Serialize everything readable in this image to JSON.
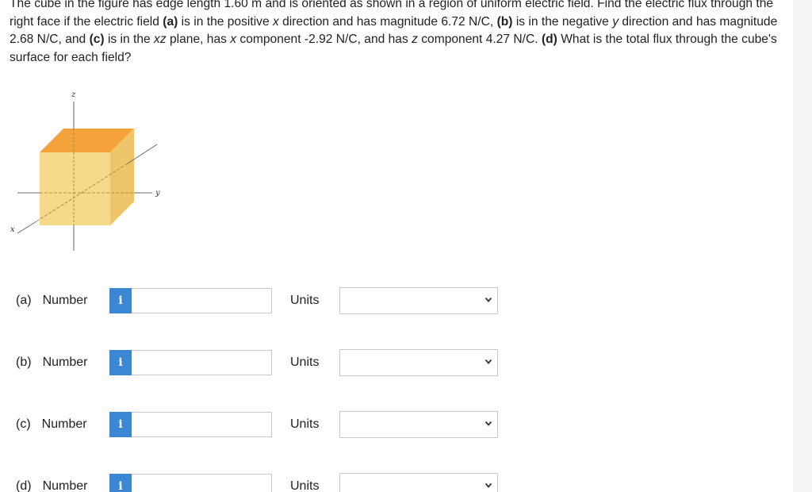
{
  "question": {
    "t1": "The cube in the figure has edge length 1.60 m and is oriented as shown in a region of uniform electric field. Find the electric flux through the right face if the electric field ",
    "a": "(a)",
    "t2": " is in the positive ",
    "x1": "x",
    "t3": " direction and has magnitude 6.72 N/C, ",
    "b": "(b)",
    "t4": " is in the negative ",
    "y1": "y",
    "t5": " direction and has magnitude 2.68 N/C, and ",
    "c": "(c)",
    "t6": " is in the ",
    "xz": "xz",
    "t7": " plane, has ",
    "x2": "x",
    "t8": " component -2.92 N/C, and has ",
    "z1": "z",
    "t9": " component 4.27 N/C. ",
    "d": "(d)",
    "t10": " What is the total flux through the cube's surface for each field?"
  },
  "figure": {
    "axis_x": "x",
    "axis_y": "y",
    "axis_z": "z",
    "cube_top_color": "#f4a23b",
    "cube_front_color": "#f7d98a",
    "cube_side_color": "#eec56a"
  },
  "parts": [
    {
      "letter": "(a)",
      "label": "Number",
      "info_icon": "i",
      "value": "",
      "units_label": "Units",
      "units_value": ""
    },
    {
      "letter": "(b)",
      "label": "Number",
      "info_icon": "i",
      "value": "",
      "units_label": "Units",
      "units_value": ""
    },
    {
      "letter": "(c)",
      "label": "Number",
      "info_icon": "i",
      "value": "",
      "units_label": "Units",
      "units_value": ""
    },
    {
      "letter": "(d)",
      "label": "Number",
      "info_icon": "i",
      "value": "",
      "units_label": "Units",
      "units_value": ""
    }
  ],
  "colors": {
    "info_button": "#3b87d4"
  }
}
